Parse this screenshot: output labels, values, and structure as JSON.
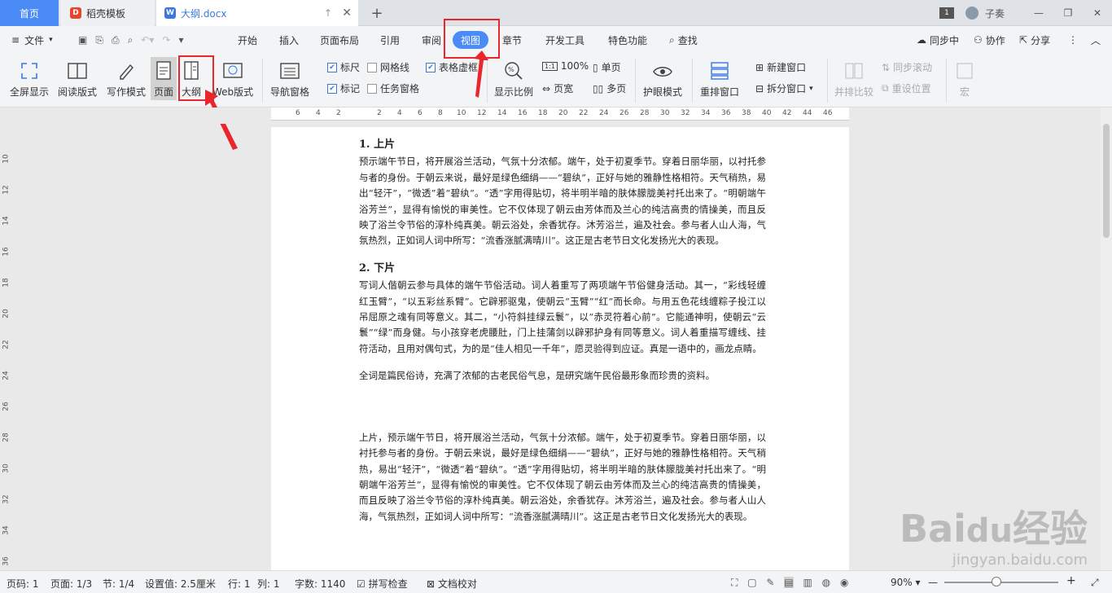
{
  "tabs": {
    "home": "首页",
    "daoke": "稻壳模板",
    "doc": "大纲.docx",
    "page_badge": "1",
    "user": "子奏"
  },
  "menu": {
    "file": "文件",
    "items": [
      "开始",
      "插入",
      "页面布局",
      "引用",
      "审阅",
      "视图",
      "章节",
      "开发工具",
      "特色功能"
    ],
    "active": "视图",
    "search": "查找",
    "sync": "同步中",
    "collab": "协作",
    "share": "分享"
  },
  "ribbon": {
    "fullscreen": "全屏显示",
    "reading": "阅读版式",
    "writing": "写作模式",
    "page": "页面",
    "outline": "大纲",
    "web": "Web版式",
    "nav": "导航窗格",
    "ruler": "标尺",
    "gridline": "网格线",
    "table_grid": "表格虚框",
    "mark": "标记",
    "taskpane": "任务窗格",
    "zoom": "显示比例",
    "zoom100": "100%",
    "single": "单页",
    "pagewidth": "页宽",
    "multi": "多页",
    "eyecare": "护眼模式",
    "rearrange": "重排窗口",
    "newwin": "新建窗口",
    "splitwin": "拆分窗口",
    "sidebyside": "并排比较",
    "syncscroll": "同步滚动",
    "resetpos": "重设位置",
    "macro": "宏"
  },
  "ruler": {
    "top": [
      "6",
      "4",
      "2",
      "2",
      "4",
      "6",
      "8",
      "10",
      "12",
      "14",
      "16",
      "18",
      "20",
      "22",
      "24",
      "26",
      "28",
      "30",
      "32",
      "34",
      "36",
      "38",
      "40",
      "42",
      "44",
      "46"
    ],
    "left": [
      "10",
      "12",
      "14",
      "16",
      "18",
      "20",
      "22",
      "24",
      "26",
      "28",
      "30",
      "32",
      "34",
      "36"
    ]
  },
  "doc": {
    "h1": "1. 上片",
    "p1": "预示端午节日，将开展浴兰活动，气氛十分浓郁。端午，处于初夏季节。穿着日丽华丽，以衬托参与者的身份。于朝云来说，最好是绿色细绢——“碧纨”，正好与她的雅静性格相符。天气稍热，易出“轻汗”，“微透”着“碧纨”。“透”字用得贴切，将半明半暗的肤体朦胧美衬托出来了。“明朝端午浴芳兰”，显得有愉悦的审美性。它不仅体现了朝云由芳体而及兰心的纯洁高贵的情操美，而且反映了浴兰令节俗的淳朴纯真美。朝云浴处，余香犹存。沐芳浴兰，遍及社会。参与者人山人海，气氛热烈，正如词人词中所写：“流香涨腻满晴川”。这正是古老节日文化发扬光大的表现。",
    "h2": "2. 下片",
    "p2": "写词人偕朝云参与具体的端午节俗活动。词人着重写了两项端午节俗健身活动。其一，“彩线轻缠红玉臂”，“以五彩丝系臂”。它辟邪驱鬼，使朝云“玉臂”“红”而长命。与用五色花线缠粽子投江以吊屈原之魂有同等意义。其二，“小符斜挂绿云鬟”，以“赤灵符着心前”。它能通神明，使朝云“云鬟”“绿”而身健。与小孩穿老虎腰肚，门上挂蒲剑以辟邪护身有同等意义。词人着重描写缠线、挂符活动，且用对偶句式，为的是“佳人相见一千年”，愿灵验得到应证。真是一语中的，画龙点睛。",
    "p3": "全词是篇民俗诗，充满了浓郁的古老民俗气息，是研究端午民俗最形象而珍贵的资料。",
    "p4": "上片，预示端午节日，将开展浴兰活动，气氛十分浓郁。端午，处于初夏季节。穿着日丽华丽，以衬托参与者的身份。于朝云来说，最好是绿色细绢——“碧纨”，正好与她的雅静性格相符。天气稍热，易出“轻汗”，“微透”着“碧纨”。“透”字用得贴切，将半明半暗的肤体朦胧美衬托出来了。“明朝端午浴芳兰”，显得有愉悦的审美性。它不仅体现了朝云由芳体而及兰心的纯洁高贵的情操美，而且反映了浴兰令节俗的淳朴纯真美。朝云浴处，余香犹存。沐芳浴兰，遍及社会。参与者人山人海，气氛热烈，正如词人词中所写：“流香涨腻满晴川”。这正是古老节日文化发扬光大的表现。"
  },
  "status": {
    "pageno": "页码: 1",
    "pages": "页面: 1/3",
    "section": "节: 1/4",
    "setting": "设置值: 2.5厘米",
    "row": "行: 1",
    "col": "列: 1",
    "words": "字数: 1140",
    "spell": "拼写检查",
    "proof": "文档校对",
    "zoom": "90%"
  },
  "watermark": {
    "brand": "Bai",
    "brand2": "经验",
    "url": "jingyan.baidu.com"
  },
  "colors": {
    "accent": "#4a8bf5",
    "highlight": "#e8262b"
  }
}
